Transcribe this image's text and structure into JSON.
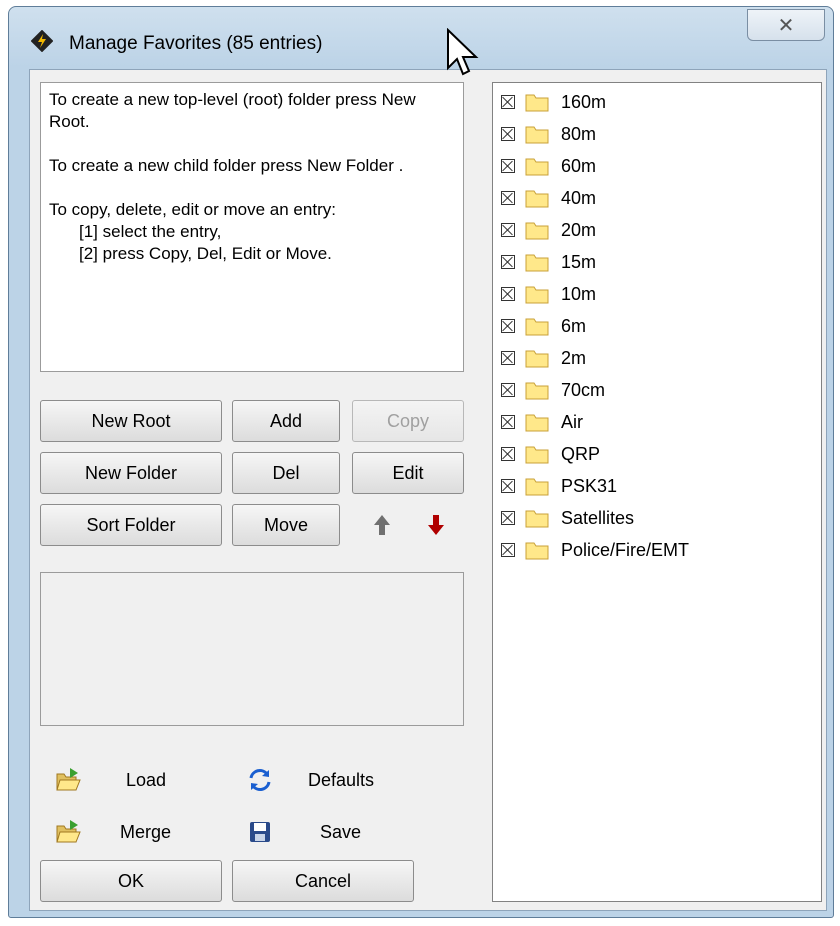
{
  "window": {
    "title": "Manage Favorites (85 entries)",
    "close_label": "✕"
  },
  "instructions": {
    "p1": "To create a new top-level (root) folder press New Root.",
    "p2": "To create a new child folder press New Folder .",
    "p3": "To copy, delete, edit or move an entry:",
    "step1": "[1] select the entry,",
    "step2": "[2] press Copy, Del, Edit or Move."
  },
  "buttons": {
    "new_root": "New Root",
    "add": "Add",
    "copy": "Copy",
    "new_folder": "New Folder",
    "del": "Del",
    "edit": "Edit",
    "sort_folder": "Sort Folder",
    "move": "Move",
    "load": "Load",
    "defaults": "Defaults",
    "merge": "Merge",
    "save": "Save",
    "ok": "OK",
    "cancel": "Cancel"
  },
  "tree": {
    "items": [
      {
        "label": "160m"
      },
      {
        "label": "80m"
      },
      {
        "label": "60m"
      },
      {
        "label": "40m"
      },
      {
        "label": "20m"
      },
      {
        "label": "15m"
      },
      {
        "label": "10m"
      },
      {
        "label": "6m"
      },
      {
        "label": "2m"
      },
      {
        "label": "70cm"
      },
      {
        "label": "Air"
      },
      {
        "label": "QRP"
      },
      {
        "label": "PSK31"
      },
      {
        "label": "Satellites"
      },
      {
        "label": "Police/Fire/EMT"
      }
    ]
  },
  "icons": {
    "app": "radio-app-icon",
    "up": "arrow-up-icon",
    "down": "arrow-down-icon",
    "load": "open-folder-icon",
    "merge": "open-folder-icon",
    "defaults": "refresh-icon",
    "save": "floppy-disk-icon"
  },
  "colors": {
    "folder_fill": "#ffe88a",
    "folder_stroke": "#c8a038",
    "down_arrow": "#b00000",
    "up_arrow": "#707070",
    "defaults_icon": "#1a5fd0",
    "save_icon": "#2a4a8a"
  }
}
